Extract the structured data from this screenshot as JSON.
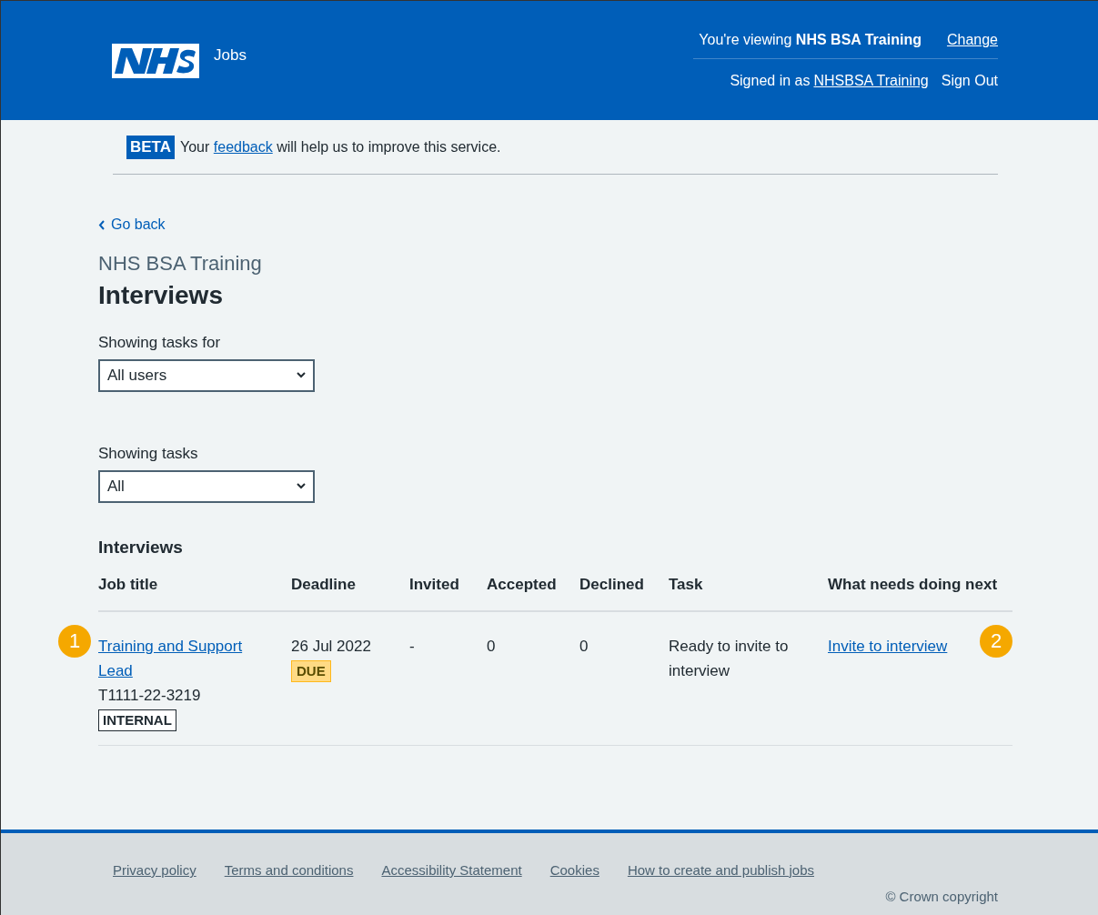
{
  "header": {
    "service": "Jobs",
    "viewing_prefix": "You're viewing",
    "viewing_org": "NHS BSA Training",
    "change_link": "Change",
    "signed_in_prefix": "Signed in as",
    "signed_in_user": "NHSBSA Training",
    "sign_out": "Sign Out"
  },
  "beta": {
    "tag": "BETA",
    "before": "Your",
    "link": "feedback",
    "after": "will help us to improve this service."
  },
  "back_link": "Go back",
  "caption": "NHS BSA Training",
  "title": "Interviews",
  "filters": [
    {
      "label": "Showing tasks for",
      "value": "All users"
    },
    {
      "label": "Showing tasks",
      "value": "All"
    }
  ],
  "table": {
    "caption": "Interviews",
    "columns": [
      "Job title",
      "Deadline",
      "Invited",
      "Accepted",
      "Declined",
      "Task",
      "What needs doing next"
    ],
    "rows": [
      {
        "job_title": "Training and Support Lead",
        "reference": "T1111-22-3219",
        "job_tag": "INTERNAL",
        "deadline": "26 Jul 2022",
        "deadline_tag": "DUE",
        "invited": "-",
        "accepted": "0",
        "declined": "0",
        "task": "Ready to invite to interview",
        "next_action": "Invite to interview"
      }
    ]
  },
  "callouts": [
    "1",
    "2"
  ],
  "footer": {
    "links": [
      "Privacy policy",
      "Terms and conditions",
      "Accessibility Statement",
      "Cookies",
      "How to create and publish jobs"
    ],
    "copyright": "© Crown copyright"
  }
}
